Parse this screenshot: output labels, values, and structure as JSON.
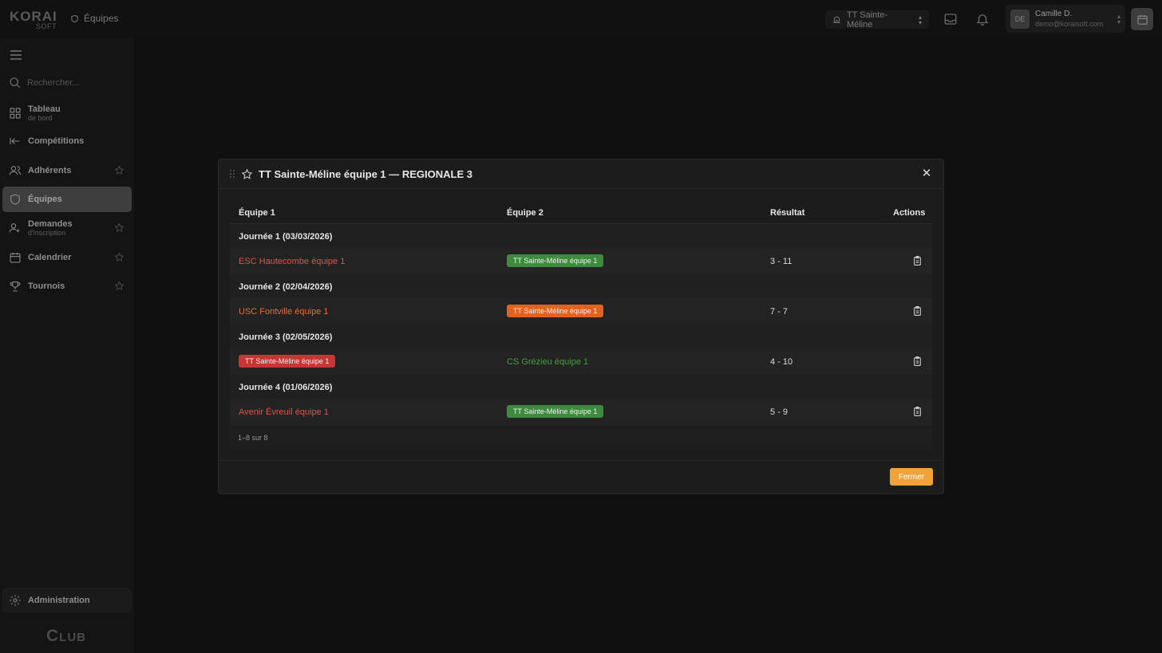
{
  "header": {
    "logo_brand": "KORAI",
    "logo_sub": "SOFT",
    "breadcrumb": "Équipes",
    "club_selector": "TT Sainte-Méline",
    "user_initials": "DE",
    "user_name": "Camille D.",
    "user_email": "demo@koraisoft.com"
  },
  "sidebar": {
    "search_placeholder": "Rechercher...",
    "items": [
      {
        "label": "Tableau",
        "sublabel": "de bord"
      },
      {
        "label": "Compétitions"
      },
      {
        "label": "Adhérents"
      },
      {
        "label": "Équipes"
      },
      {
        "label": "Demandes",
        "sublabel": "d'inscription"
      },
      {
        "label": "Calendrier"
      },
      {
        "label": "Tournois"
      }
    ],
    "admin_label": "Administration",
    "footer_word": "Club"
  },
  "modal": {
    "title": "TT Sainte-Méline équipe 1 — REGIONALE 3",
    "columns": {
      "team1": "Équipe 1",
      "team2": "Équipe 2",
      "result": "Résultat",
      "actions": "Actions"
    },
    "groups": [
      {
        "label": "Journée 1 (03/03/2026)",
        "team1": "ESC Hautecombe équipe 1",
        "team2": "TT Sainte-Méline équipe 1",
        "result": "3 - 11"
      },
      {
        "label": "Journée 2 (02/04/2026)",
        "team1": "USC Fontville équipe 1",
        "team2": "TT Sainte-Méline équipe 1",
        "result": "7 - 7"
      },
      {
        "label": "Journée 3 (02/05/2026)",
        "team1": "TT Sainte-Méline équipe 1",
        "team2": "CS Grézieu équipe 1",
        "result": "4 - 10"
      },
      {
        "label": "Journée 4 (01/06/2026)",
        "team1": "Avenir Évreuil équipe 1",
        "team2": "TT Sainte-Méline équipe 1",
        "result": "5 - 9"
      }
    ],
    "pagination": "1–8 sur 8",
    "close_button": "Fermer"
  },
  "colors": {
    "win": "#3e8a3e",
    "draw": "#e2621f",
    "loss": "#c73535",
    "accent": "#f0a33a"
  }
}
